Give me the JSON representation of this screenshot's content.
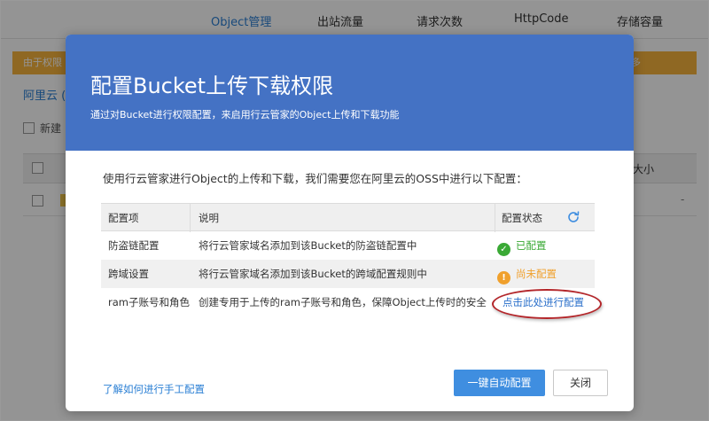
{
  "background": {
    "tabs": [
      "Object管理",
      "出站流量",
      "请求次数",
      "HttpCode",
      "存储容量"
    ],
    "warning_left": "由于权限",
    "warning_right": "多",
    "bucket_label": "阿里云 (",
    "new_label": "新建",
    "size_header": "大小",
    "row_value": "-"
  },
  "modal": {
    "title": "配置Bucket上传下载权限",
    "subtitle": "通过对Bucket进行权限配置，来启用行云管家的Object上传和下载功能",
    "intro": "使用行云管家进行Object的上传和下载，我们需要您在阿里云的OSS中进行以下配置：",
    "table": {
      "headers": [
        "配置项",
        "说明",
        "配置状态"
      ],
      "rows": [
        {
          "item": "防盗链配置",
          "desc": "将行云管家域名添加到该Bucket的防盗链配置中",
          "status": "已配置",
          "status_type": "ok"
        },
        {
          "item": "跨域设置",
          "desc": "将行云管家域名添加到该Bucket的跨域配置规则中",
          "status": "尚未配置",
          "status_type": "warn"
        },
        {
          "item": "ram子账号和角色",
          "desc": "创建专用于上传的ram子账号和角色，保障Object上传时的安全",
          "status": "点击此处进行配置",
          "status_type": "link"
        }
      ]
    },
    "manual_link": "了解如何进行手工配置",
    "auto_button": "一键自动配置",
    "close_button": "关闭"
  },
  "colors": {
    "header_blue": "#4472c4",
    "ok_green": "#3aa935",
    "warn_orange": "#f0a02c",
    "primary_button": "#3f8ee0",
    "highlight_red": "#b3262a"
  }
}
